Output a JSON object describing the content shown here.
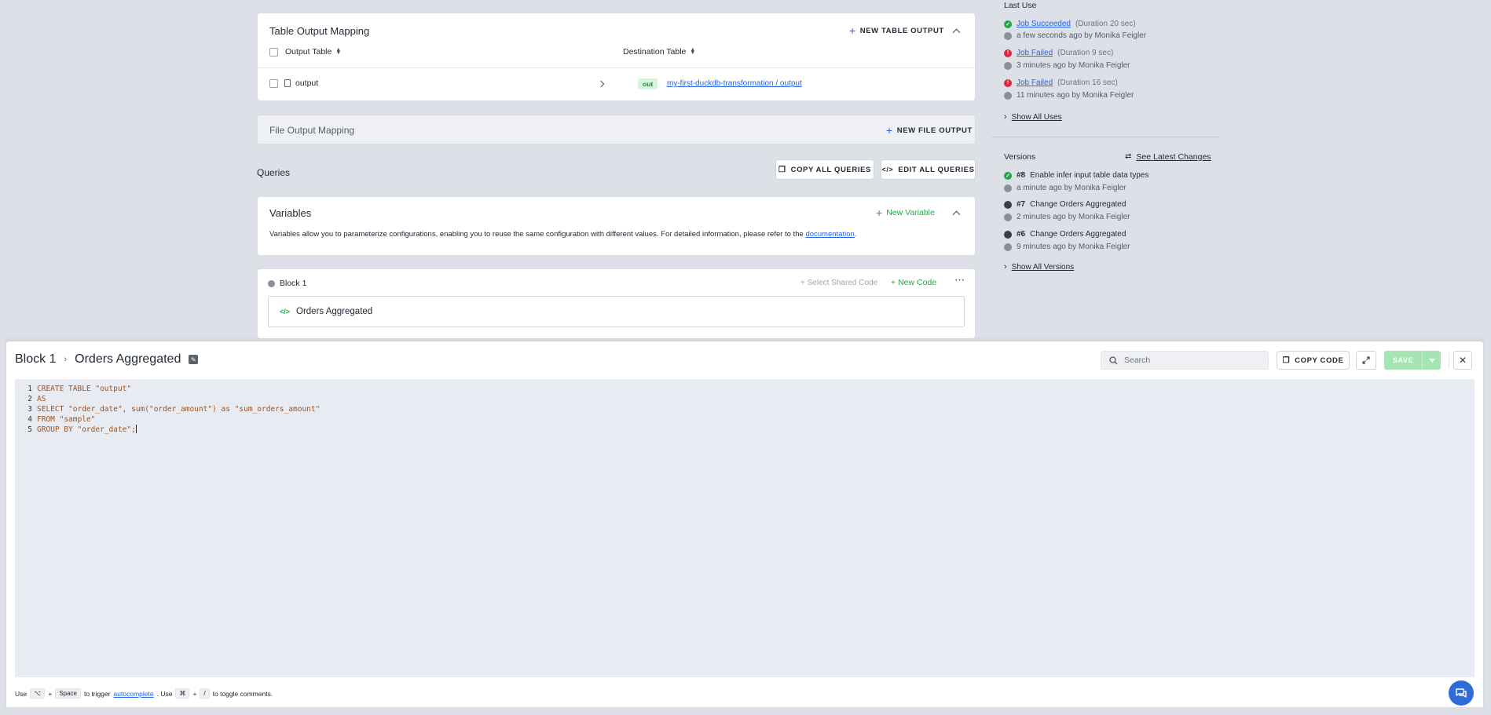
{
  "table_output": {
    "title": "Table Output Mapping",
    "new_button": "NEW TABLE OUTPUT",
    "col_output": "Output Table",
    "col_destination": "Destination Table",
    "row_name": "output",
    "row_badge": "out",
    "row_destination": "my-first-duckdb-transformation / output"
  },
  "file_output": {
    "title": "File Output Mapping",
    "new_button": "NEW FILE OUTPUT"
  },
  "queries": {
    "title": "Queries",
    "copy_all": "COPY ALL QUERIES",
    "edit_all": "EDIT ALL QUERIES"
  },
  "variables": {
    "title": "Variables",
    "new_button": "New Variable",
    "description": "Variables allow you to parameterize configurations, enabling you to reuse the same configuration with different values. For detailed information, please refer to the",
    "doc_link": "documentation",
    "period": "."
  },
  "block": {
    "name": "Block 1",
    "select_shared": "Select Shared Code",
    "new_code": "New Code",
    "code_name": "Orders Aggregated"
  },
  "last_use": {
    "title": "Last Use",
    "items": [
      {
        "status": "Job Succeeded",
        "duration": "(Duration 20 sec)",
        "when": "a few seconds ago by Monika Feigler"
      },
      {
        "status": "Job Failed",
        "duration": "(Duration 9 sec)",
        "when": "3 minutes ago by Monika Feigler"
      },
      {
        "status": "Job Failed",
        "duration": "(Duration 16 sec)",
        "when": "11 minutes ago by Monika Feigler"
      }
    ],
    "show_all": "Show All Uses"
  },
  "versions": {
    "title": "Versions",
    "latest_changes": "See Latest Changes",
    "items": [
      {
        "num": "#8",
        "desc": "Enable infer input table data types",
        "when": "a minute ago by Monika Feigler"
      },
      {
        "num": "#7",
        "desc": "Change Orders Aggregated",
        "when": "2 minutes ago by Monika Feigler"
      },
      {
        "num": "#6",
        "desc": "Change Orders Aggregated",
        "when": "9 minutes ago by Monika Feigler"
      }
    ],
    "show_all": "Show All Versions"
  },
  "editor": {
    "block": "Block 1",
    "sep": "›",
    "title": "Orders Aggregated",
    "search_placeholder": "Search",
    "copy_code": "COPY CODE",
    "save": "SAVE",
    "lines": [
      "CREATE TABLE \"output\"",
      "AS",
      "SELECT \"order_date\", sum(\"order_amount\") as \"sum_orders_amount\"",
      "FROM \"sample\"",
      "GROUP BY \"order_date\";"
    ],
    "line_numbers": [
      "1",
      "2",
      "3",
      "4",
      "5"
    ],
    "footer": {
      "use1": "Use",
      "key1a": "⌥",
      "plus": "+",
      "key1b": "Space",
      "trigger": "to trigger",
      "autocomplete": "autocomplete",
      "use2": ". Use",
      "key2a": "⌘",
      "key2b": "/",
      "toggle": "to toggle comments."
    }
  },
  "colors": {
    "accent_green": "#22a84a",
    "link_blue": "#2563eb",
    "error_red": "#e0243a",
    "save_disabled": "#a4e5b3"
  }
}
